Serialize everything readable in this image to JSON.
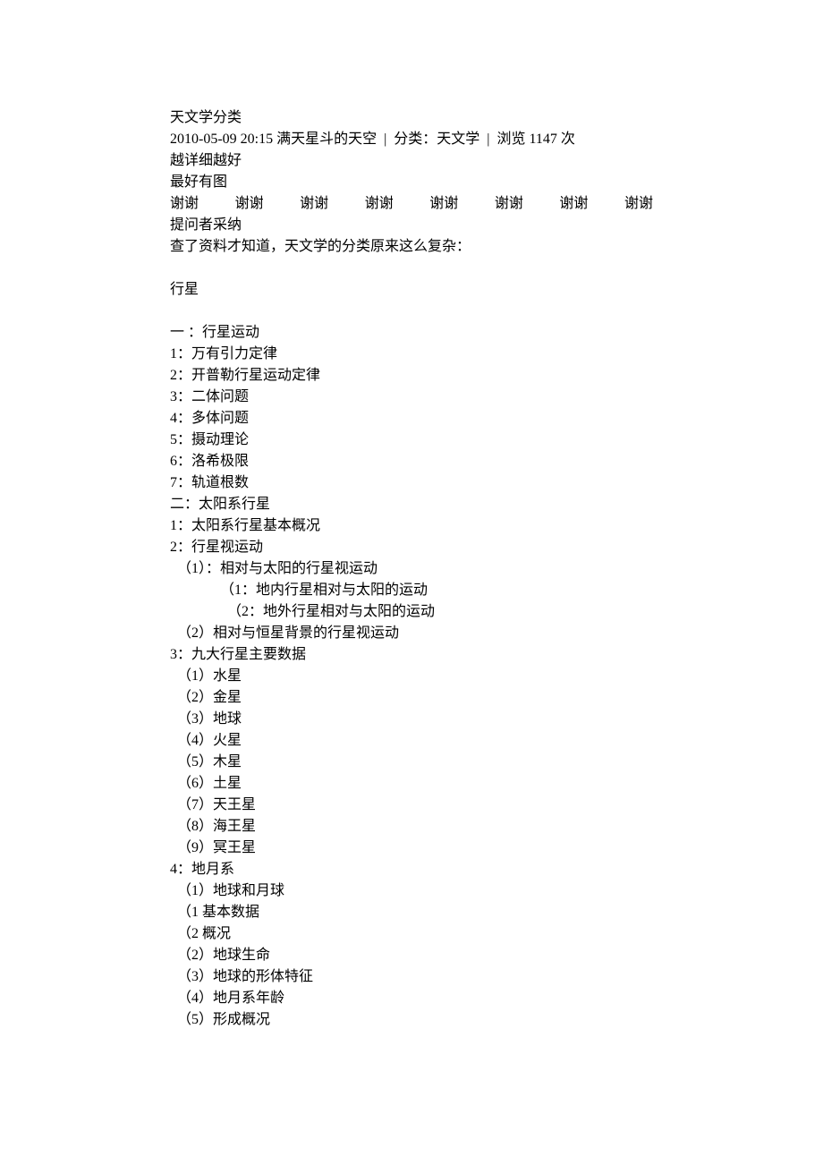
{
  "title": "天文学分类",
  "meta_line": "2010-05-09 20:15 满天星斗的天空  |  分类：天文学  |  浏览 1147 次",
  "req1": "越详细越好",
  "req2": "最好有图",
  "thanks": [
    "谢谢",
    "谢谢",
    "谢谢",
    "谢谢",
    "谢谢",
    "谢谢",
    "谢谢",
    "谢谢"
  ],
  "adopt": "提问者采纳",
  "intro": "查了资料才知道，天文学的分类原来这么复杂：",
  "section_planet": "行星",
  "h1": "一 ：行星运动",
  "h1_items": [
    "1：万有引力定律",
    "2：开普勒行星运动定律",
    "3：二体问题",
    "4：多体问题",
    "5：摄动理论",
    "6：洛希极限",
    "7：轨道根数"
  ],
  "h2": "二：太阳系行星",
  "h2_1": "1：太阳系行星基本概况",
  "h2_2": "2：行星视运动",
  "h2_2_1": "（1）：相对与太阳的行星视运动",
  "h2_2_1a": "（1：地内行星相对与太阳的运动",
  "h2_2_1b": "（2：地外行星相对与太阳的运动",
  "h2_2_2": "（2）相对与恒星背景的行星视运动",
  "h2_3": "3：九大行星主要数据",
  "h2_3_items": [
    "（1）水星",
    "（2）金星",
    "（3）地球",
    "（4）火星",
    "（5）木星",
    "（6）土星",
    "（7）天王星",
    "（8）海王星",
    "（9）冥王星"
  ],
  "h2_4": "4：地月系",
  "h2_4_items": [
    "（1）地球和月球",
    "（1 基本数据",
    "（2 概况",
    "（2）地球生命",
    "（3）地球的形体特征",
    "（4）地月系年龄",
    "（5）形成概况"
  ]
}
